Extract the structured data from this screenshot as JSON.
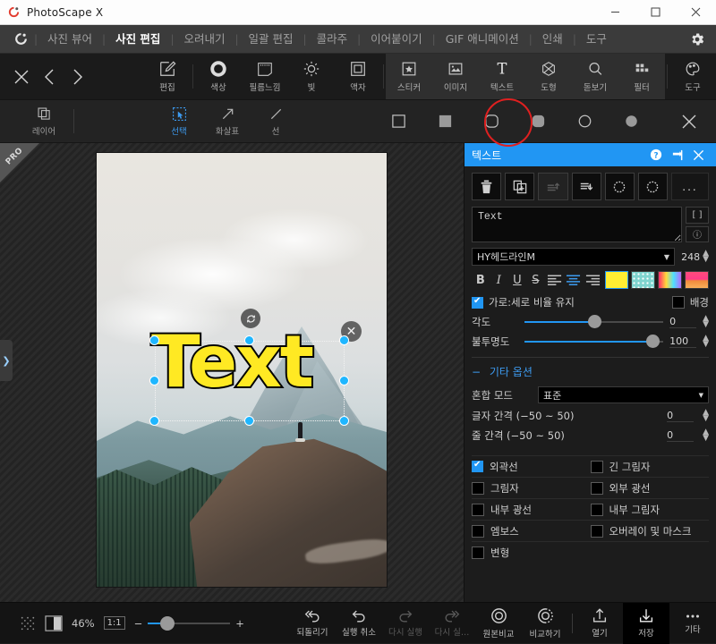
{
  "window": {
    "title": "PhotoScape X",
    "controls": {
      "minimize": "—",
      "maximize": "□",
      "close": "✕"
    }
  },
  "menubar": {
    "items": [
      {
        "label": "사진 뷰어",
        "active": false
      },
      {
        "label": "사진 편집",
        "active": true
      },
      {
        "label": "오려내기",
        "active": false
      },
      {
        "label": "일괄 편집",
        "active": false
      },
      {
        "label": "콜라주",
        "active": false
      },
      {
        "label": "이어붙이기",
        "active": false
      },
      {
        "label": "GIF 애니메이션",
        "active": false
      },
      {
        "label": "인쇄",
        "active": false
      },
      {
        "label": "도구",
        "active": false
      }
    ],
    "separator": "|",
    "settings_icon": "gear-icon"
  },
  "toolbar": {
    "nav": {
      "close": "✕",
      "prev": "‹",
      "next": "›"
    },
    "tools": [
      {
        "label": "편집",
        "icon": "edit-icon",
        "selected": false
      },
      {
        "label": "색상",
        "icon": "color-icon",
        "selected": false
      },
      {
        "label": "필름느낌",
        "icon": "film-icon",
        "selected": false
      },
      {
        "label": "빛",
        "icon": "light-icon",
        "selected": false
      },
      {
        "label": "액자",
        "icon": "frame-icon",
        "selected": false
      },
      {
        "label": "스티커",
        "icon": "sticker-icon",
        "selected": true
      },
      {
        "label": "이미지",
        "icon": "image-icon",
        "selected": true
      },
      {
        "label": "텍스트",
        "icon": "text-icon",
        "selected": true,
        "highlighted": true
      },
      {
        "label": "도형",
        "icon": "shape-icon",
        "selected": true
      },
      {
        "label": "돋보기",
        "icon": "magnifier-icon",
        "selected": true
      },
      {
        "label": "필터",
        "icon": "filter-icon",
        "selected": true
      },
      {
        "label": "도구",
        "icon": "palette-icon",
        "selected": false
      }
    ],
    "highlight_color": "#e02020"
  },
  "subbar": {
    "layer": {
      "label": "레이어",
      "icon": "layers-icon"
    },
    "draw_tools": [
      {
        "label": "선택",
        "icon": "select-icon",
        "active": true
      },
      {
        "label": "화살표",
        "icon": "arrow-icon",
        "active": false
      },
      {
        "label": "선",
        "icon": "line-icon",
        "active": false
      }
    ],
    "shapes": [
      "square-outline-icon",
      "square-filled-icon",
      "rounded-square-outline-icon",
      "rounded-square-filled-icon",
      "circle-outline-icon",
      "circle-filled-icon"
    ],
    "close": "✕"
  },
  "canvas": {
    "pro_badge": "PRO",
    "overlay_text": "Text",
    "overlay_text_color": "#ffe923",
    "overlay_outline_color": "#000000",
    "rotate_handle": "rotate-icon",
    "delete_handle": "✕"
  },
  "panel": {
    "title": "텍스트",
    "header_color": "#2196f3",
    "header_icons": {
      "help": "?",
      "pin": "pin-icon",
      "close": "✕"
    },
    "actions": [
      {
        "name": "delete",
        "icon": "trash-icon",
        "disabled": false
      },
      {
        "name": "duplicate",
        "icon": "duplicate-icon",
        "disabled": false
      },
      {
        "name": "bring-forward",
        "icon": "bring-forward-icon",
        "disabled": true
      },
      {
        "name": "send-backward",
        "icon": "send-backward-icon",
        "disabled": false
      },
      {
        "name": "rotate-left",
        "icon": "rotate-left-icon",
        "disabled": false
      },
      {
        "name": "rotate-right",
        "icon": "rotate-right-icon",
        "disabled": false
      },
      {
        "name": "more",
        "icon": "more-icon",
        "label": "...",
        "disabled": false
      }
    ],
    "text_input": {
      "value": "Text",
      "placeholder": "Text"
    },
    "text_side_buttons": [
      "[  ]",
      "ⓘ"
    ],
    "font": {
      "family": "HY헤드라인M",
      "size": "248"
    },
    "format": {
      "bold": "B",
      "italic": "I",
      "underline": "U",
      "strike": "S",
      "align_left": "align-left-icon",
      "align_center": "align-center-icon",
      "align_right": "align-right-icon",
      "align_active": "center",
      "swatches": [
        {
          "name": "solid-color",
          "value": "#ffee33",
          "selected": true
        },
        {
          "name": "pattern",
          "value": "#7fd4cf",
          "selected": false
        },
        {
          "name": "gradient",
          "value": "#ff3bd4",
          "selected": false
        },
        {
          "name": "texture",
          "value": "#ff5577",
          "selected": false
        }
      ]
    },
    "aspect_lock": {
      "label": "가로:세로 비율 유지",
      "checked": true
    },
    "background": {
      "label": "배경",
      "checked": false,
      "color": "#000000"
    },
    "angle": {
      "label": "각도",
      "value": "0",
      "percent": 50
    },
    "opacity": {
      "label": "불투명도",
      "value": "100",
      "percent": 92
    },
    "other_options": {
      "title": "기타 옵션",
      "collapse": "−",
      "blend_mode": {
        "label": "혼합 모드",
        "value": "표준"
      },
      "letter_spacing": {
        "label": "글자 간격 (−50 ~ 50)",
        "value": "0"
      },
      "line_spacing": {
        "label": "줄 간격 (−50 ~ 50)",
        "value": "0"
      }
    },
    "effects": [
      {
        "label": "외곽선",
        "checked": true
      },
      {
        "label": "긴 그림자",
        "checked": false
      },
      {
        "label": "그림자",
        "checked": false
      },
      {
        "label": "외부 광선",
        "checked": false
      },
      {
        "label": "내부 광선",
        "checked": false
      },
      {
        "label": "내부 그림자",
        "checked": false
      },
      {
        "label": "엠보스",
        "checked": false
      },
      {
        "label": "오버레이 및 마스크",
        "checked": false
      },
      {
        "label": "변형",
        "checked": false
      }
    ]
  },
  "bottombar": {
    "grid_icon": "grid-icon",
    "split_icon": "split-view-icon",
    "zoom_percent": "46%",
    "one_to_one": "1:1",
    "zoom_out": "−",
    "zoom_in": "+",
    "buttons": [
      {
        "label": "되돌리기",
        "icon": "undo-all-icon",
        "disabled": false,
        "selected": false
      },
      {
        "label": "실행 취소",
        "icon": "undo-icon",
        "disabled": false,
        "selected": false
      },
      {
        "label": "다시 실행",
        "icon": "redo-icon",
        "disabled": true,
        "selected": false
      },
      {
        "label": "다시 실…",
        "icon": "redo-all-icon",
        "disabled": true,
        "selected": false
      },
      {
        "label": "원본비교",
        "icon": "compare-original-icon",
        "disabled": false,
        "selected": false
      },
      {
        "label": "비교하기",
        "icon": "compare-icon",
        "disabled": false,
        "selected": false
      },
      {
        "label": "열기",
        "icon": "open-icon",
        "disabled": false,
        "selected": false
      },
      {
        "label": "저장",
        "icon": "save-icon",
        "disabled": false,
        "selected": true
      },
      {
        "label": "기타",
        "icon": "more-icon",
        "disabled": false,
        "selected": false
      }
    ]
  }
}
